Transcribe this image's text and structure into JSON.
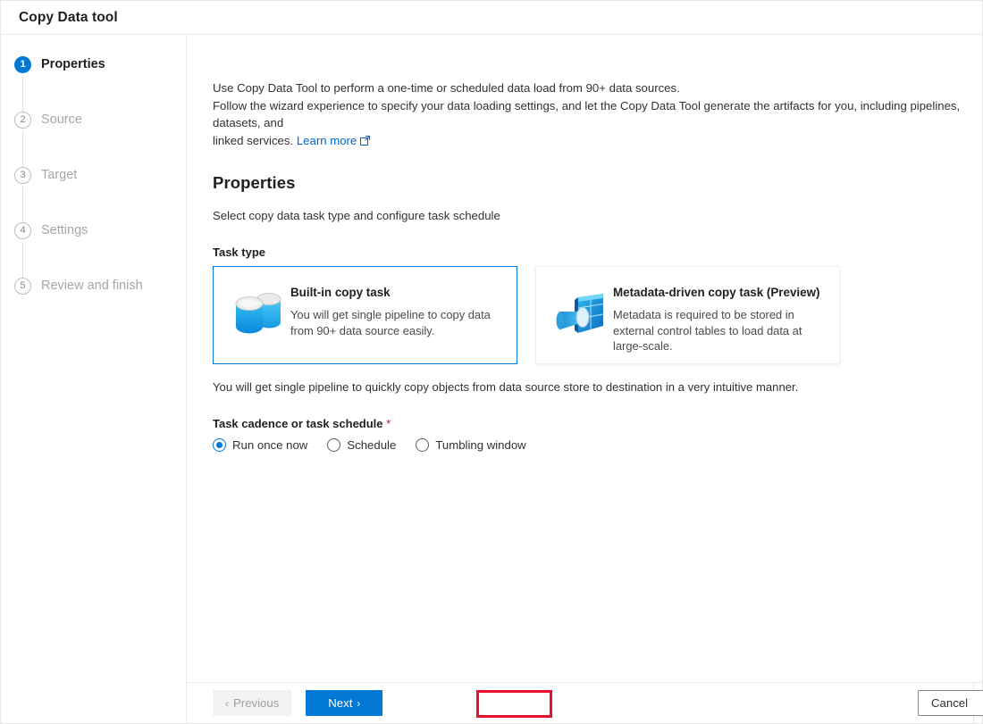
{
  "window": {
    "title": "Copy Data tool"
  },
  "sidebar": {
    "steps": [
      {
        "number": "1",
        "label": "Properties",
        "state": "active"
      },
      {
        "number": "2",
        "label": "Source",
        "state": "idle"
      },
      {
        "number": "3",
        "label": "Target",
        "state": "idle"
      },
      {
        "number": "4",
        "label": "Settings",
        "state": "idle"
      },
      {
        "number": "5",
        "label": "Review and finish",
        "state": "idle"
      }
    ]
  },
  "main": {
    "intro_line1": "Use Copy Data Tool to perform a one-time or scheduled data load from 90+ data sources.",
    "intro_line2": "Follow the wizard experience to specify your data loading settings, and let the Copy Data Tool generate the artifacts for you, including pipelines, datasets, and",
    "intro_line3": "linked services.",
    "learn_more_label": "Learn more",
    "section_title": "Properties",
    "section_subtitle": "Select copy data task type and configure task schedule",
    "task_type_label": "Task type",
    "cards": [
      {
        "icon": "database-stack-icon",
        "title": "Built-in copy task",
        "description": "You will get single pipeline to copy data from 90+ data source easily.",
        "selected": true
      },
      {
        "icon": "metadata-table-icon",
        "title": "Metadata-driven copy task (Preview)",
        "description": "Metadata is required to be stored in external control tables to load data at large-scale.",
        "selected": false
      }
    ],
    "helper_text": "You will get single pipeline to quickly copy objects from data source store to destination in a very intuitive manner.",
    "cadence_label": "Task cadence or task schedule",
    "cadence_required_marker": "*",
    "cadence_options": [
      {
        "label": "Run once now",
        "checked": true
      },
      {
        "label": "Schedule",
        "checked": false
      },
      {
        "label": "Tumbling window",
        "checked": false
      }
    ]
  },
  "footer": {
    "previous_label": "Previous",
    "next_label": "Next",
    "cancel_label": "Cancel",
    "previous_chevron": "‹",
    "next_chevron": "›"
  },
  "colors": {
    "accent": "#0078d4",
    "annotation": "#e8112d",
    "link": "#0066cc",
    "required": "#a4262c"
  }
}
